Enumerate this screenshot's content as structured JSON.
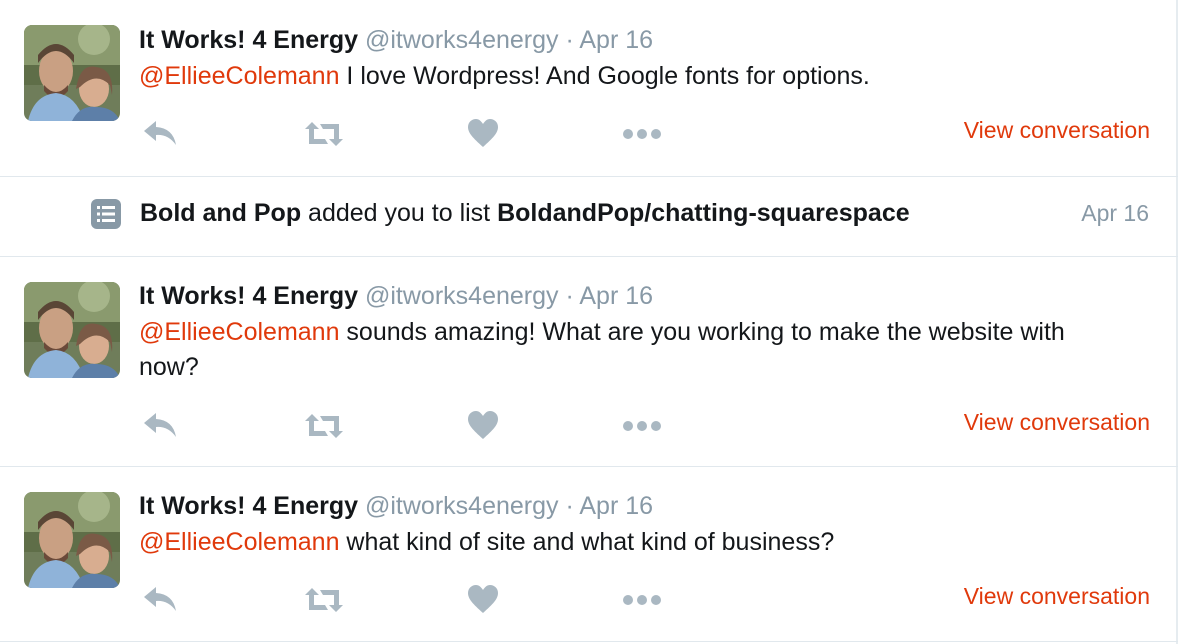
{
  "colors": {
    "accent": "#e0390b",
    "muted": "#8899a6",
    "icon": "#aab8c2",
    "text": "#14171a",
    "divider": "#e1e8ed"
  },
  "tweets": [
    {
      "name": "It Works! 4 Energy",
      "handle": "@itworks4energy",
      "separator": "·",
      "time": "Apr 16",
      "mention": "@EllieeColemann",
      "text": " I love Wordpress! And Google fonts for options.",
      "view_conversation": "View conversation"
    },
    {
      "name": "It Works! 4 Energy",
      "handle": "@itworks4energy",
      "separator": "·",
      "time": "Apr 16",
      "mention": "@EllieeColemann",
      "text": " sounds amazing! What are you working to make the website with now?",
      "view_conversation": "View conversation"
    },
    {
      "name": "It Works! 4 Energy",
      "handle": "@itworks4energy",
      "separator": "·",
      "time": "Apr 16",
      "mention": "@EllieeColemann",
      "text": " what kind of site and what kind of business?",
      "view_conversation": "View conversation"
    }
  ],
  "list_notification": {
    "icon": "list-icon",
    "actor": "Bold and Pop",
    "action": " added you to list ",
    "list_name": "BoldandPop/chatting-squarespace",
    "time": "Apr 16"
  },
  "action_icons": [
    "reply-icon",
    "retweet-icon",
    "like-icon",
    "more-icon"
  ]
}
